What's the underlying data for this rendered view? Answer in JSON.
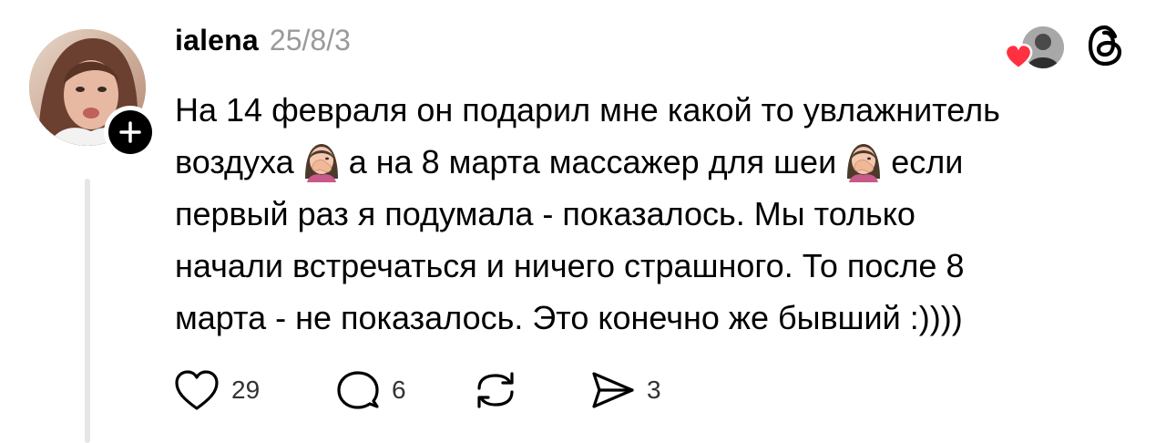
{
  "post": {
    "author": {
      "username": "ialena",
      "avatar_icon": "profile-photo",
      "follow_icon": "plus-icon"
    },
    "timestamp": "25/8/3",
    "text_lines": [
      {
        "before": "На 14 февраля он подарил мне какой то увлажнитель",
        "emoji": null,
        "after": ""
      },
      {
        "before": "воздуха",
        "emoji": "face-palm-woman",
        "after": "а на 8 марта массажер для шеи",
        "emoji2": "face-palm-woman",
        "after2": "если"
      },
      {
        "before": "первый раз я подумала - показалось. Мы только",
        "emoji": null,
        "after": ""
      },
      {
        "before": "начали встречаться и ничего страшного. То после 8",
        "emoji": null,
        "after": ""
      },
      {
        "before": "марта - не показалось. Это конечно же бывший :))))",
        "emoji": null,
        "after": ""
      }
    ],
    "actions": {
      "like": {
        "icon": "heart-outline-icon",
        "count": "29"
      },
      "reply": {
        "icon": "comment-bubble-icon",
        "count": "6"
      },
      "repost": {
        "icon": "repost-icon",
        "count": ""
      },
      "share": {
        "icon": "send-icon",
        "count": "3"
      }
    },
    "top_right": {
      "liked_by_icon": "liker-avatar",
      "liked_heart_color": "#ff3040",
      "app_icon": "threads-logo-icon"
    }
  },
  "colors": {
    "text": "#000000",
    "muted": "#9a9a9a",
    "thread_line": "#e6e6e6",
    "heart": "#ff3040"
  }
}
